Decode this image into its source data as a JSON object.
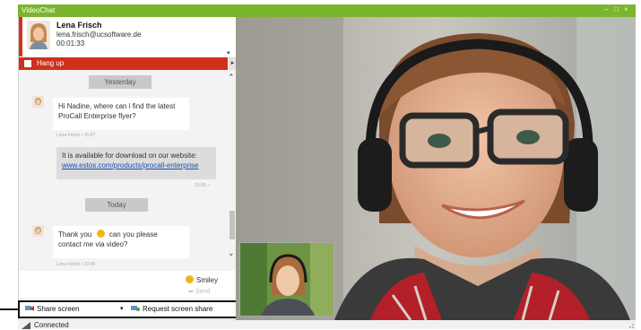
{
  "window": {
    "title": "VideoChat",
    "controls": [
      "–",
      "□",
      "×"
    ]
  },
  "contact": {
    "name": "Lena Frisch",
    "email": "lena.frisch@ucsoftware.de",
    "duration": "00:01:33"
  },
  "hangup": {
    "label": "Hang up"
  },
  "chat": {
    "day1": "Yesterday",
    "msg1": {
      "line1": "Hi Nadine, where can i find the latest",
      "line2": "ProCall Enterprise flyer?",
      "meta": "Lena Frisch • 15:07"
    },
    "msg2": {
      "line1": "It is available for download on our website:",
      "link": "www.estos.com/products/procall-enterprise",
      "time": "15:09 ✓"
    },
    "day2": "Today",
    "msg3": {
      "pre": "Thank you",
      "post": "can you please",
      "line2": "contact me via video?",
      "meta": "Lena Frisch • 10:45"
    }
  },
  "composer": {
    "smiley_label": "Smiley",
    "send_label": "Send"
  },
  "toolbar": {
    "share_label": "Share screen",
    "request_label": "Request screen share"
  },
  "status": {
    "label": "Connected"
  },
  "colors": {
    "accent": "#7bb52f",
    "hangup": "#d0301b",
    "link": "#1a4fb0"
  }
}
